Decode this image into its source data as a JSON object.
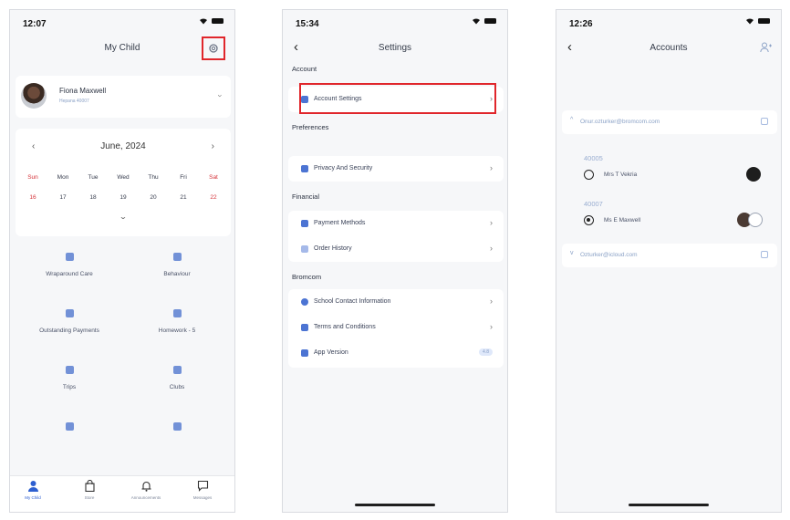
{
  "screen1": {
    "time": "12:07",
    "title": "My Child",
    "child": {
      "name": "Fiona Maxwell",
      "subtitle": "Hepana 40007"
    },
    "calendar": {
      "month": "June, 2024",
      "days": [
        "Sun",
        "Mon",
        "Tue",
        "Wed",
        "Thu",
        "Fri",
        "Sat"
      ],
      "dates": [
        "16",
        "17",
        "18",
        "19",
        "20",
        "21",
        "22"
      ]
    },
    "tiles": [
      "Wraparound Care",
      "Behaviour",
      "Outstanding Payments",
      "Homework - 5",
      "Trips",
      "Clubs",
      "",
      ""
    ],
    "tabs": [
      "My Child",
      "Store",
      "Announcements",
      "Messages"
    ]
  },
  "screen2": {
    "time": "15:34",
    "title": "Settings",
    "sections": {
      "account": "Account",
      "preferences": "Preferences",
      "financial": "Financial",
      "bromcom": "Bromcom"
    },
    "rows": {
      "account_settings": "Account Settings",
      "privacy": "Privacy And Security",
      "payment_methods": "Payment Methods",
      "order_history": "Order History",
      "school_contact": "School Contact Information",
      "terms": "Terms and Conditions",
      "app_version": "App Version",
      "app_version_badge": "4.8"
    }
  },
  "screen3": {
    "time": "12:26",
    "title": "Accounts",
    "primary_account": "Onur.ozturker@bromcom.com",
    "secondary_account": "Ozturker@icloud.com",
    "groups": [
      {
        "id": "40005",
        "name": "Mrs T Vekria",
        "selected": false
      },
      {
        "id": "40007",
        "name": "Ms E Maxwell",
        "selected": true
      }
    ]
  },
  "colors": {
    "highlight": "#e0262b",
    "accent": "#2d5fd0",
    "weekend": "#d5343b"
  },
  "icons": [
    "gear-icon",
    "back-icon",
    "add-user-icon",
    "chevron-right-icon",
    "radio-icon"
  ]
}
